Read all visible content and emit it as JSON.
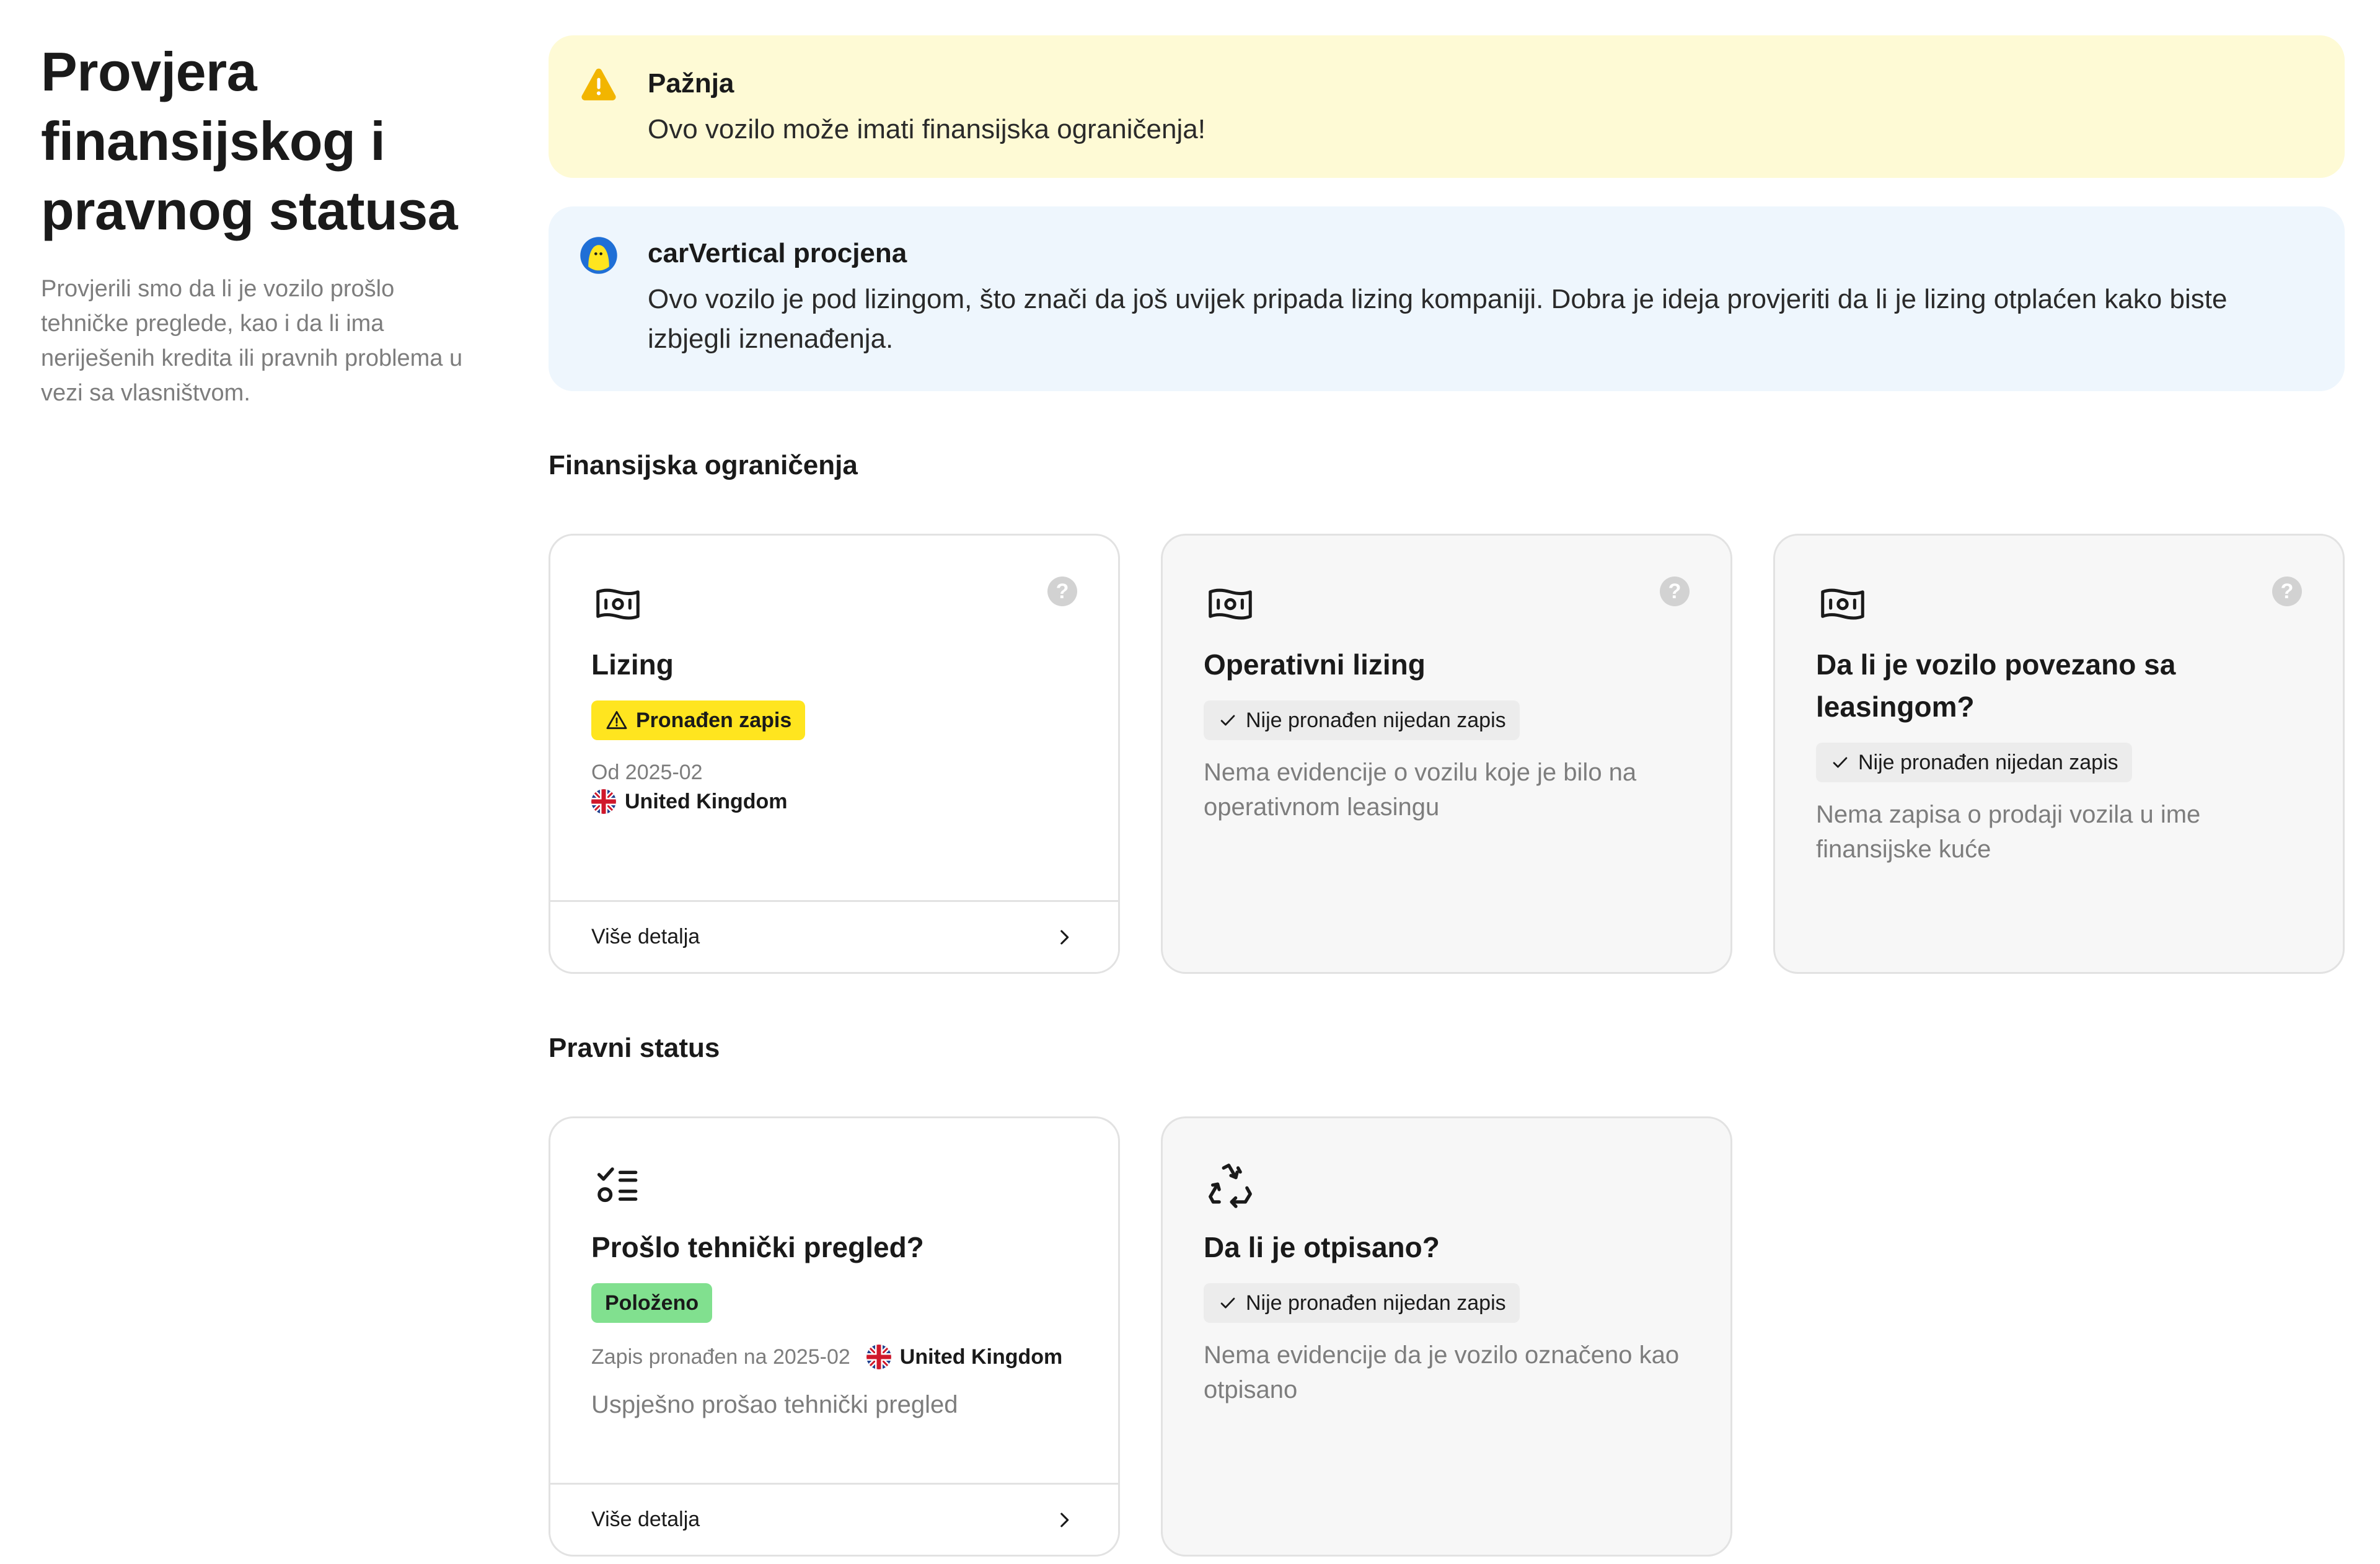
{
  "header": {
    "title": "Provjera finansijskog i pravnog statusa",
    "description": "Provjerili smo da li je vozilo prošlo tehničke preglede, kao i da li ima neriješenih kredita ili pravnih problema u vezi sa vlasništvom."
  },
  "alerts": {
    "warning": {
      "icon": "warning-triangle-icon",
      "title": "Pažnja",
      "text": "Ovo vozilo može imati finansijska ograničenja!"
    },
    "assessment": {
      "icon": "carvertical-avatar-icon",
      "title": "carVertical procjena",
      "text": "Ovo vozilo je pod lizingom, što znači da još uvijek pripada lizing kompaniji. Dobra je ideja provjeriti da li je lizing otplaćen kako biste izbjegli iznenađenja."
    }
  },
  "financial": {
    "title": "Finansijska ograničenja",
    "cards": [
      {
        "icon": "money-note-icon",
        "title": "Lizing",
        "badge": "Pronađen zapis",
        "date": "Od 2025-02",
        "country": "United Kingdom",
        "details": "Više detalja"
      },
      {
        "icon": "money-note-icon",
        "title": "Operativni lizing",
        "badge": "Nije pronađen nijedan zapis",
        "desc": "Nema evidencije o vozilu koje je bilo na operativnom leasingu"
      },
      {
        "icon": "money-note-icon",
        "title": "Da li je vozilo povezano sa leasingom?",
        "badge": "Nije pronađen nijedan zapis",
        "desc": "Nema zapisa o prodaji vozila u ime finansijske kuće"
      }
    ]
  },
  "legal": {
    "title": "Pravni status",
    "cards": [
      {
        "icon": "checklist-icon",
        "title": "Prošlo tehnički pregled?",
        "badge": "Položeno",
        "date": "Zapis pronađen na 2025-02",
        "country": "United Kingdom",
        "desc": "Uspješno prošao tehnički pregled",
        "details": "Više detalja"
      },
      {
        "icon": "recycle-icon",
        "title": "Da li je otpisano?",
        "badge": "Nije pronađen nijedan zapis",
        "desc": "Nema evidencije da je vozilo označeno kao otpisano"
      }
    ]
  },
  "colors": {
    "warning_bg": "#fefad5",
    "info_bg": "#eef6fd",
    "found_badge": "#ffe51f",
    "passed_badge": "#81e08f"
  }
}
